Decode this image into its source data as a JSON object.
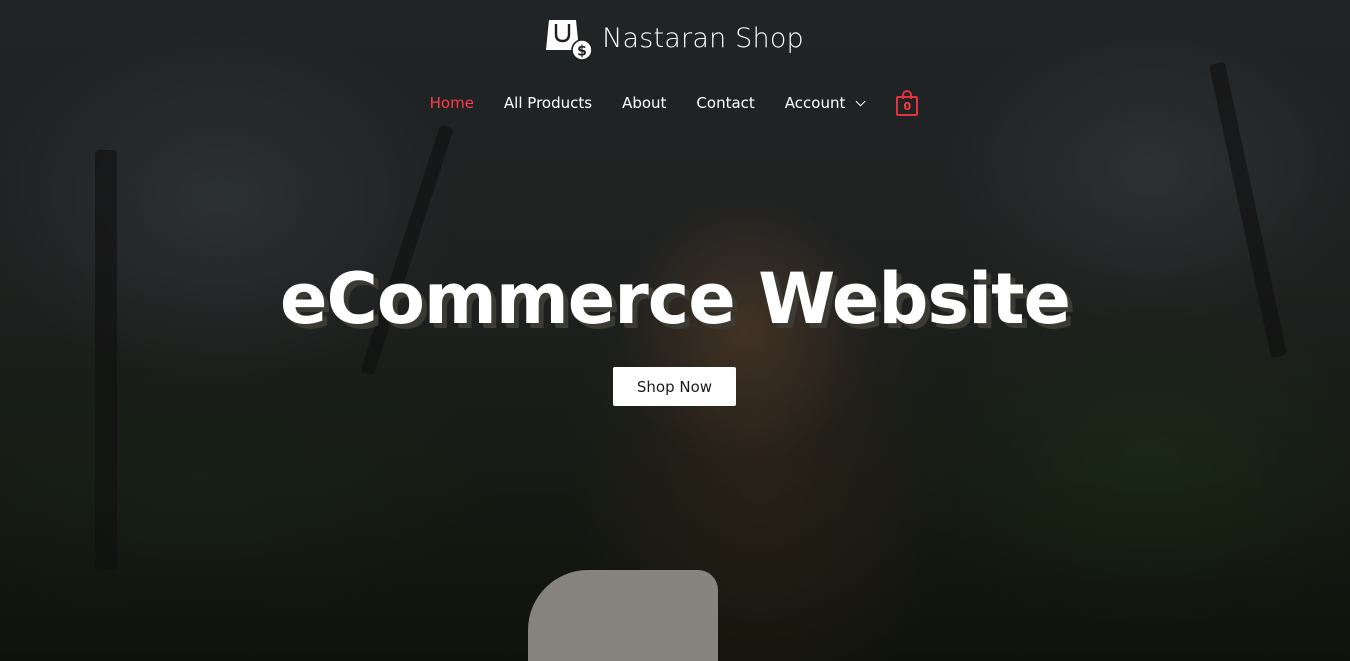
{
  "brand": {
    "name": "Nastaran Shop",
    "logo_icon": "shopping-bag-dollar-icon"
  },
  "nav": {
    "items": [
      {
        "label": "Home",
        "active": true
      },
      {
        "label": "All Products",
        "active": false
      },
      {
        "label": "About",
        "active": false
      },
      {
        "label": "Contact",
        "active": false
      },
      {
        "label": "Account",
        "active": false,
        "dropdown": true
      }
    ],
    "cart_count": "0",
    "cart_icon": "shopping-bag-icon"
  },
  "hero": {
    "title": "eCommerce Website",
    "cta_label": "Shop Now"
  },
  "colors": {
    "accent": "#ff3b47",
    "cart": "#e2323d",
    "text_light": "#ffffff"
  }
}
